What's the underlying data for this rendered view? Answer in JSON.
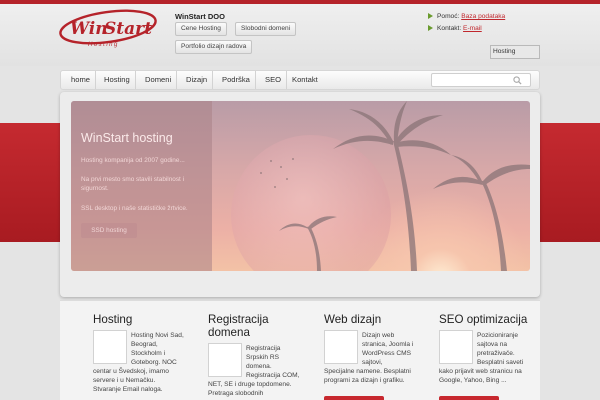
{
  "header": {
    "company": "WinStart DOO",
    "buttons": [
      "Cene Hosting",
      "Slobodni domeni",
      "Portfolio dizajn radova"
    ],
    "contact": {
      "help_label": "Pomoć:",
      "help_link": "Baza podataka",
      "contact_label": "Kontakt:",
      "contact_link": "E-mail"
    },
    "selector_value": "Hosting"
  },
  "logo": {
    "text_win": "Win",
    "text_start": "Start",
    "text_sub": "Hosting"
  },
  "nav": {
    "items": [
      "home",
      "Hosting",
      "Domeni",
      "Dizajn",
      "Podrška",
      "SEO",
      "Kontakt"
    ]
  },
  "hero": {
    "title": "WinStart hosting",
    "lines": [
      "Hosting kompanija od 2007 godine...",
      "Na prvi mesto smo stavili stabilnost i",
      "sigurnost.",
      "SSL desktop i naše statističke žrtvice."
    ],
    "button": "SSD hosting"
  },
  "columns": [
    {
      "title_lines": [
        "Hosting"
      ],
      "text_lines": [
        "Hosting Novi Sad,",
        "Beograd,",
        "Stockholm i",
        "Goteborg. NOC",
        "centar u Švedskoj, imamo",
        "servere i u Nemačku.",
        "Stvaranje Email naloga."
      ]
    },
    {
      "title_lines": [
        "Registracija",
        "domena"
      ],
      "text_lines": [
        "Registracija",
        "Srpskih RS",
        "domena.",
        "Registracija COM,",
        "NET, SE i druge topdomene.",
        "Pretraga slobodnih"
      ]
    },
    {
      "title_lines": [
        "Web dizajn"
      ],
      "text_lines": [
        "Dizajn web",
        "stranica, Joomla i",
        "WordPress CMS",
        "sajtovi,",
        "Specijalne namene. Besplatni",
        "programi za dizajn i grafiku."
      ]
    },
    {
      "title_lines": [
        "SEO optimizacija"
      ],
      "text_lines": [
        "Pozicioniranje",
        "sajtova na",
        "pretraživače.",
        "Besplatni saveti",
        "kako prijavit web stranicu na",
        "Google, Yahoo, Bing ..."
      ]
    }
  ],
  "colors": {
    "brand_red": "#b5232a",
    "link_red": "#c0272d",
    "arrow_green": "#6a9b2e"
  }
}
